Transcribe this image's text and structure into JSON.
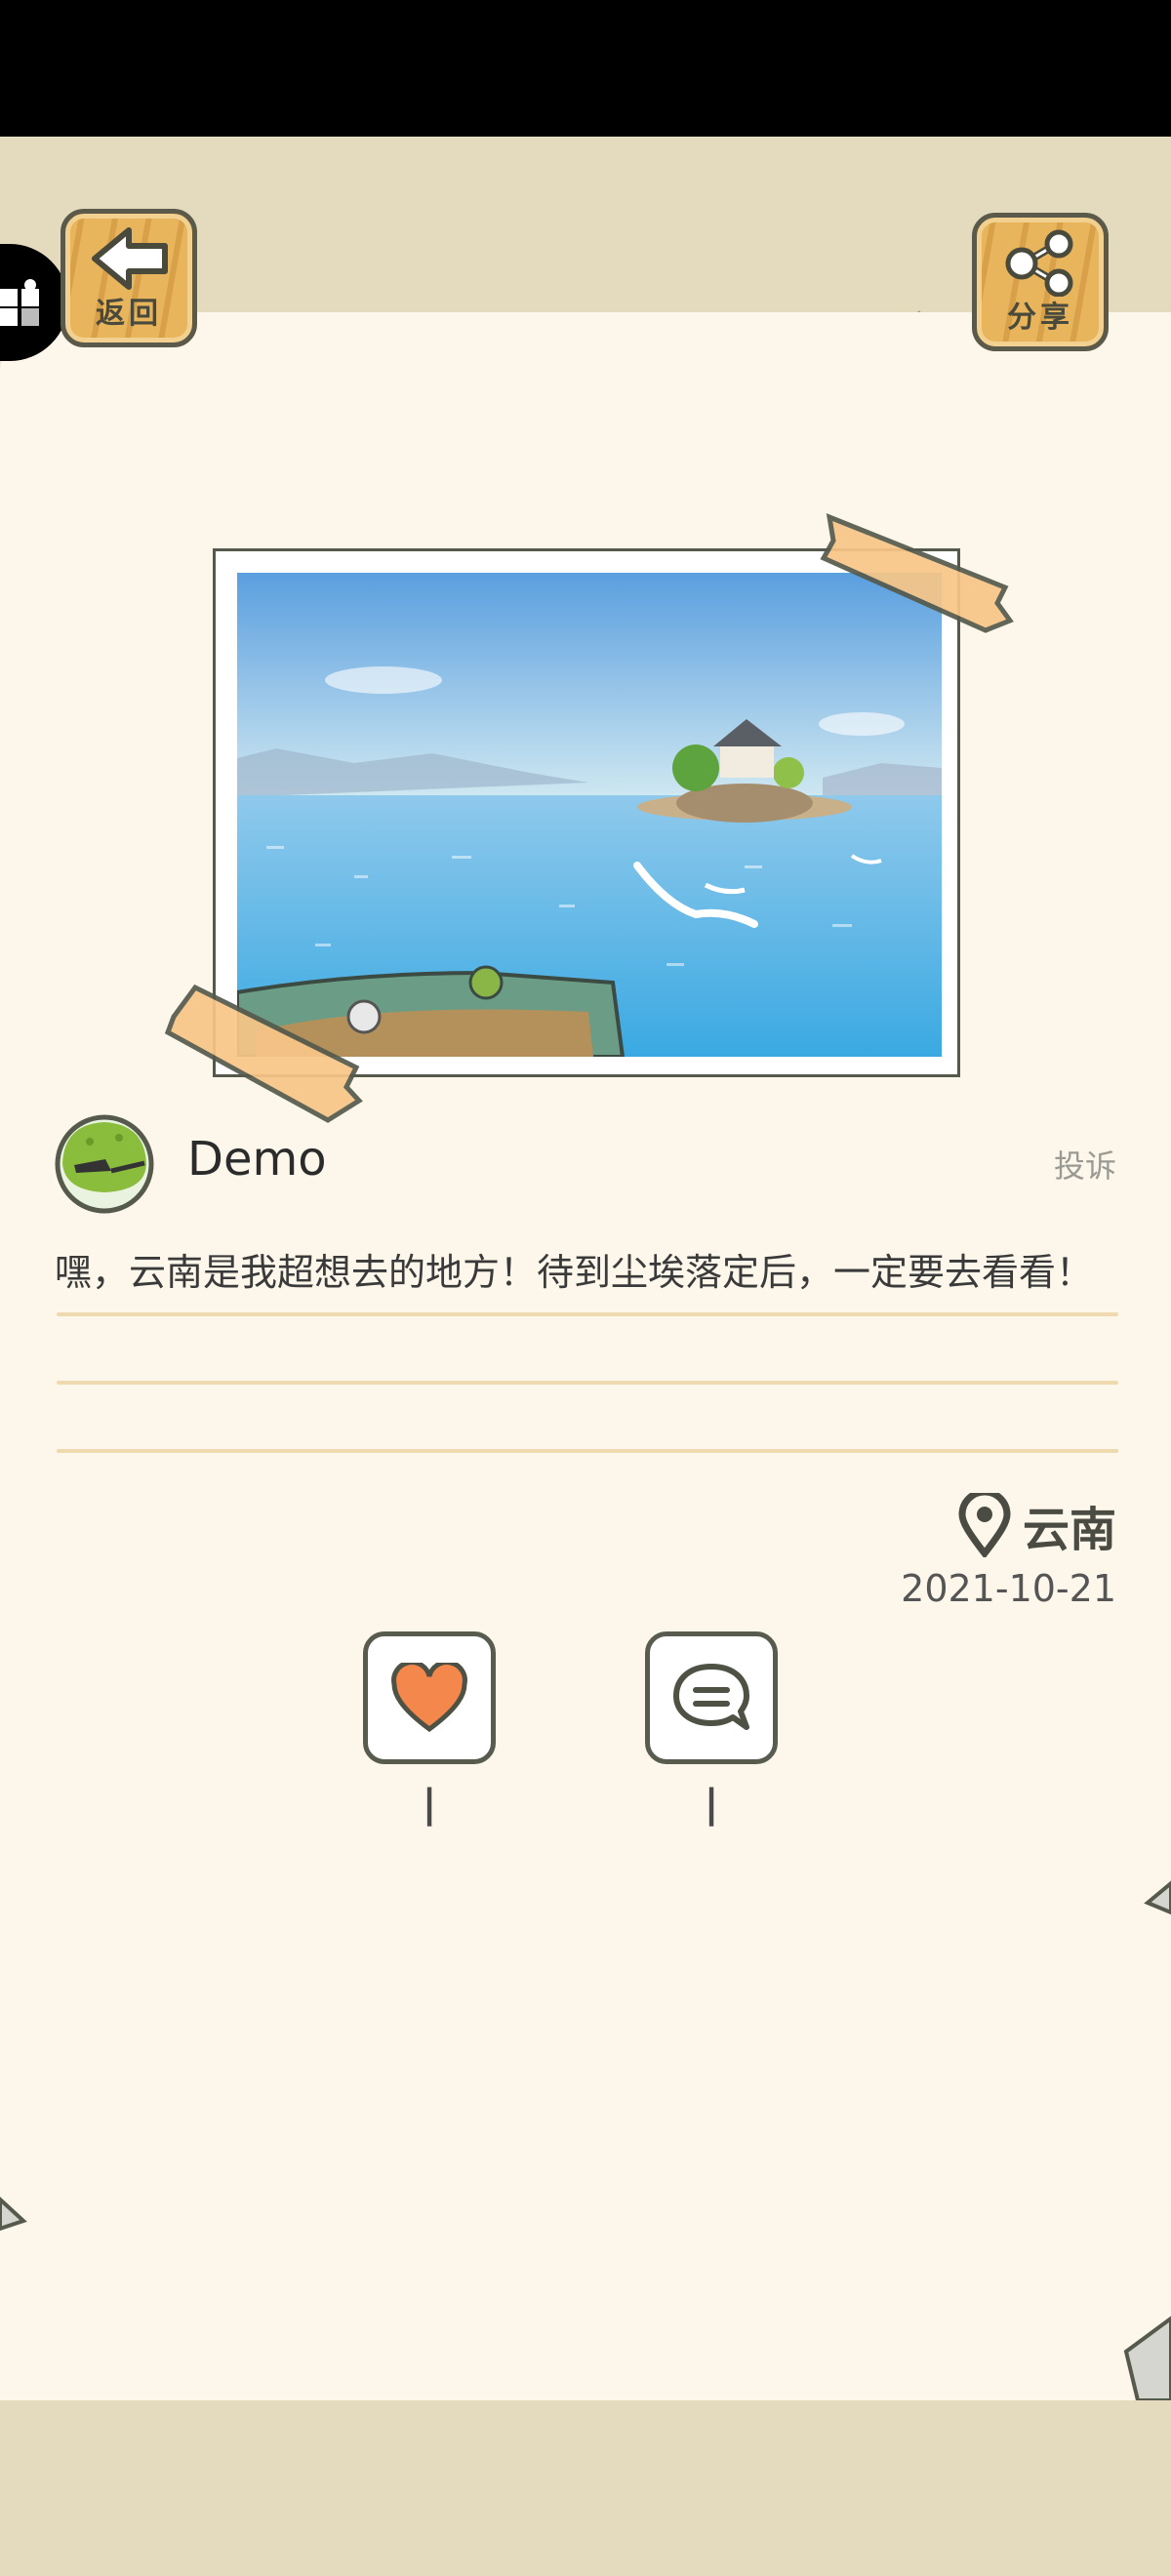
{
  "header": {
    "back_label": "返回",
    "share_label": "分享"
  },
  "post": {
    "username": "Demo",
    "report_label": "投诉",
    "text": "嘿，云南是我超想去的地方！待到尘埃落定后，一定要去看看！",
    "location": "云南",
    "date": "2021-10-21",
    "like_count": "|",
    "comment_count": "|"
  },
  "colors": {
    "paper": "#fdf6ea",
    "band": "#e4dabd",
    "wood": "#e8b45c",
    "like_heart": "#f4874b",
    "ruled_line": "#efd9ae",
    "snail": "#c87ec0"
  },
  "icons": {
    "back": "arrow-left-icon",
    "share": "share-icon",
    "location": "map-pin-icon",
    "like": "heart-icon",
    "comment": "speech-bubble-icon",
    "side": "puzzle-icon"
  }
}
